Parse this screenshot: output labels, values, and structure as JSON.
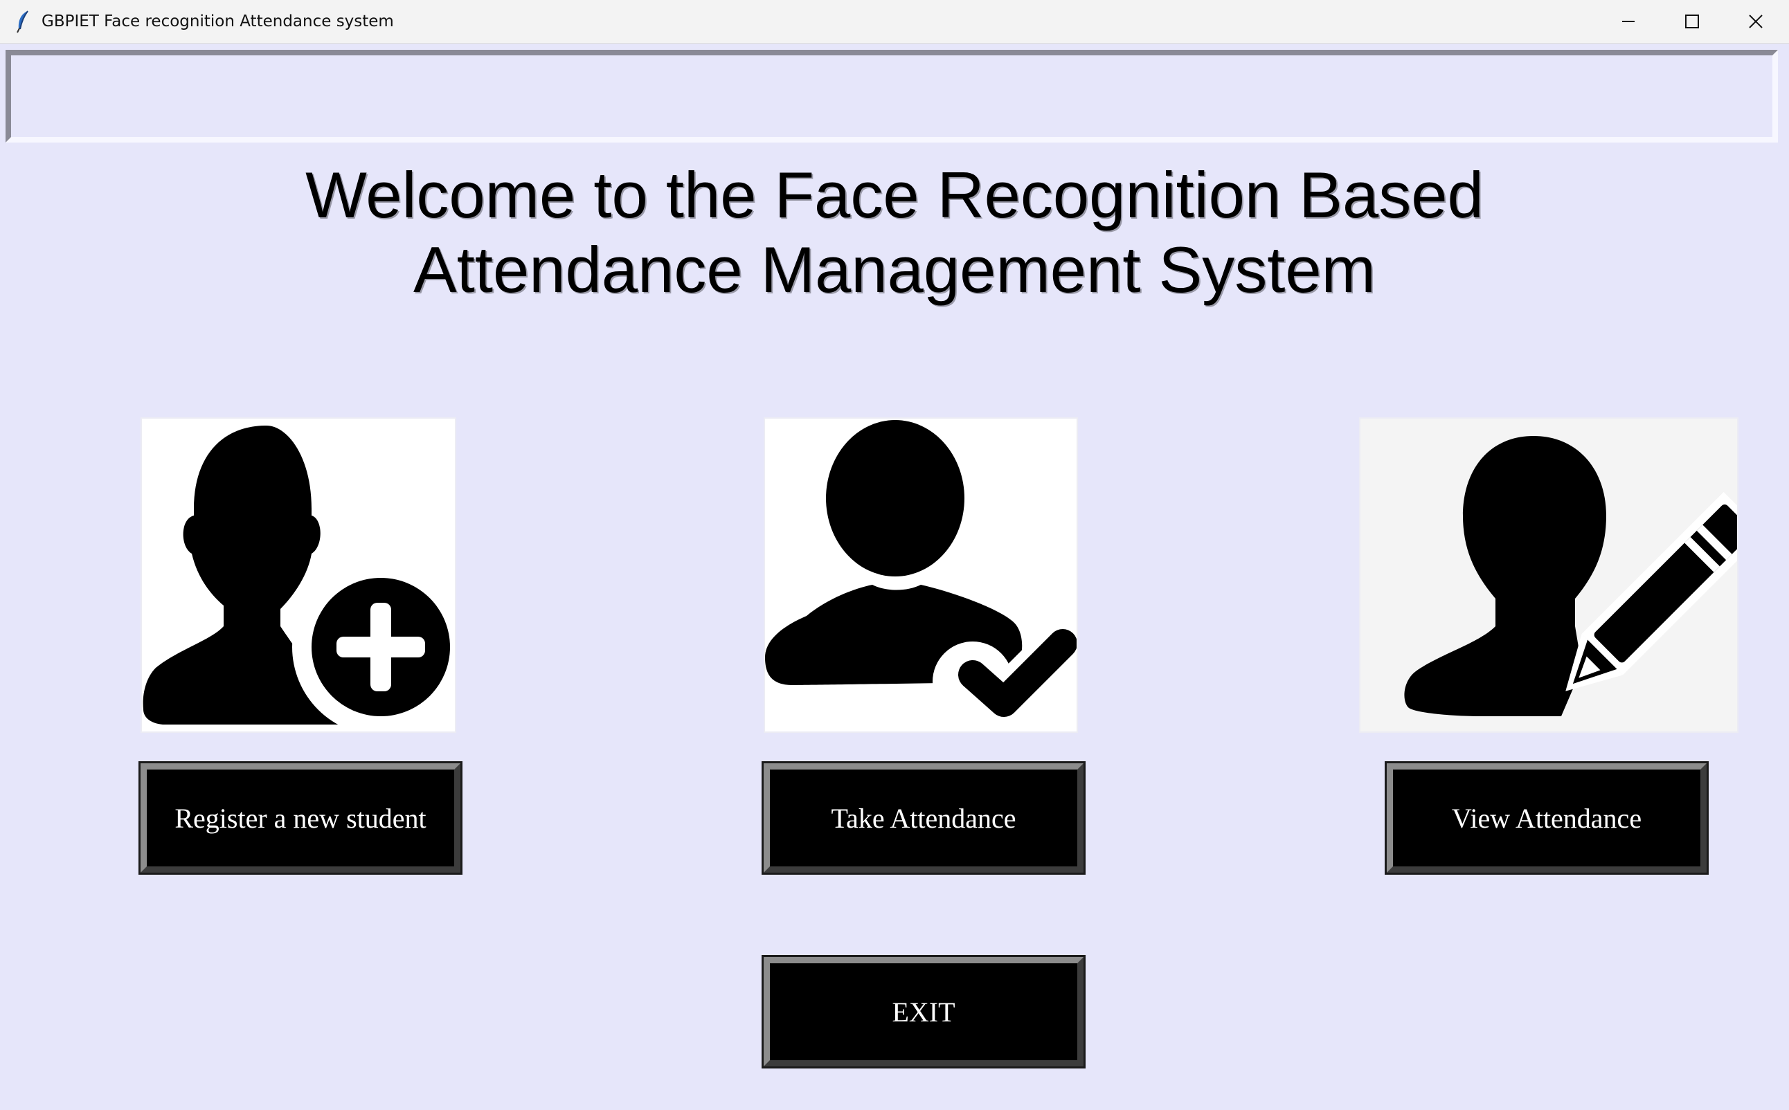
{
  "window": {
    "title": "GBPIET Face recognition Attendance system"
  },
  "heading": {
    "line1": "Welcome to the Face Recognition Based",
    "line2": "Attendance Management System"
  },
  "icons": {
    "register": "add-user-icon",
    "take": "user-check-icon",
    "view": "user-edit-icon"
  },
  "buttons": {
    "register": "Register a new student",
    "take": "Take Attendance",
    "view": "View Attendance",
    "exit": "EXIT"
  },
  "colors": {
    "background": "#e6e6fa",
    "button_bg": "#000000",
    "button_text": "#ffffff"
  }
}
